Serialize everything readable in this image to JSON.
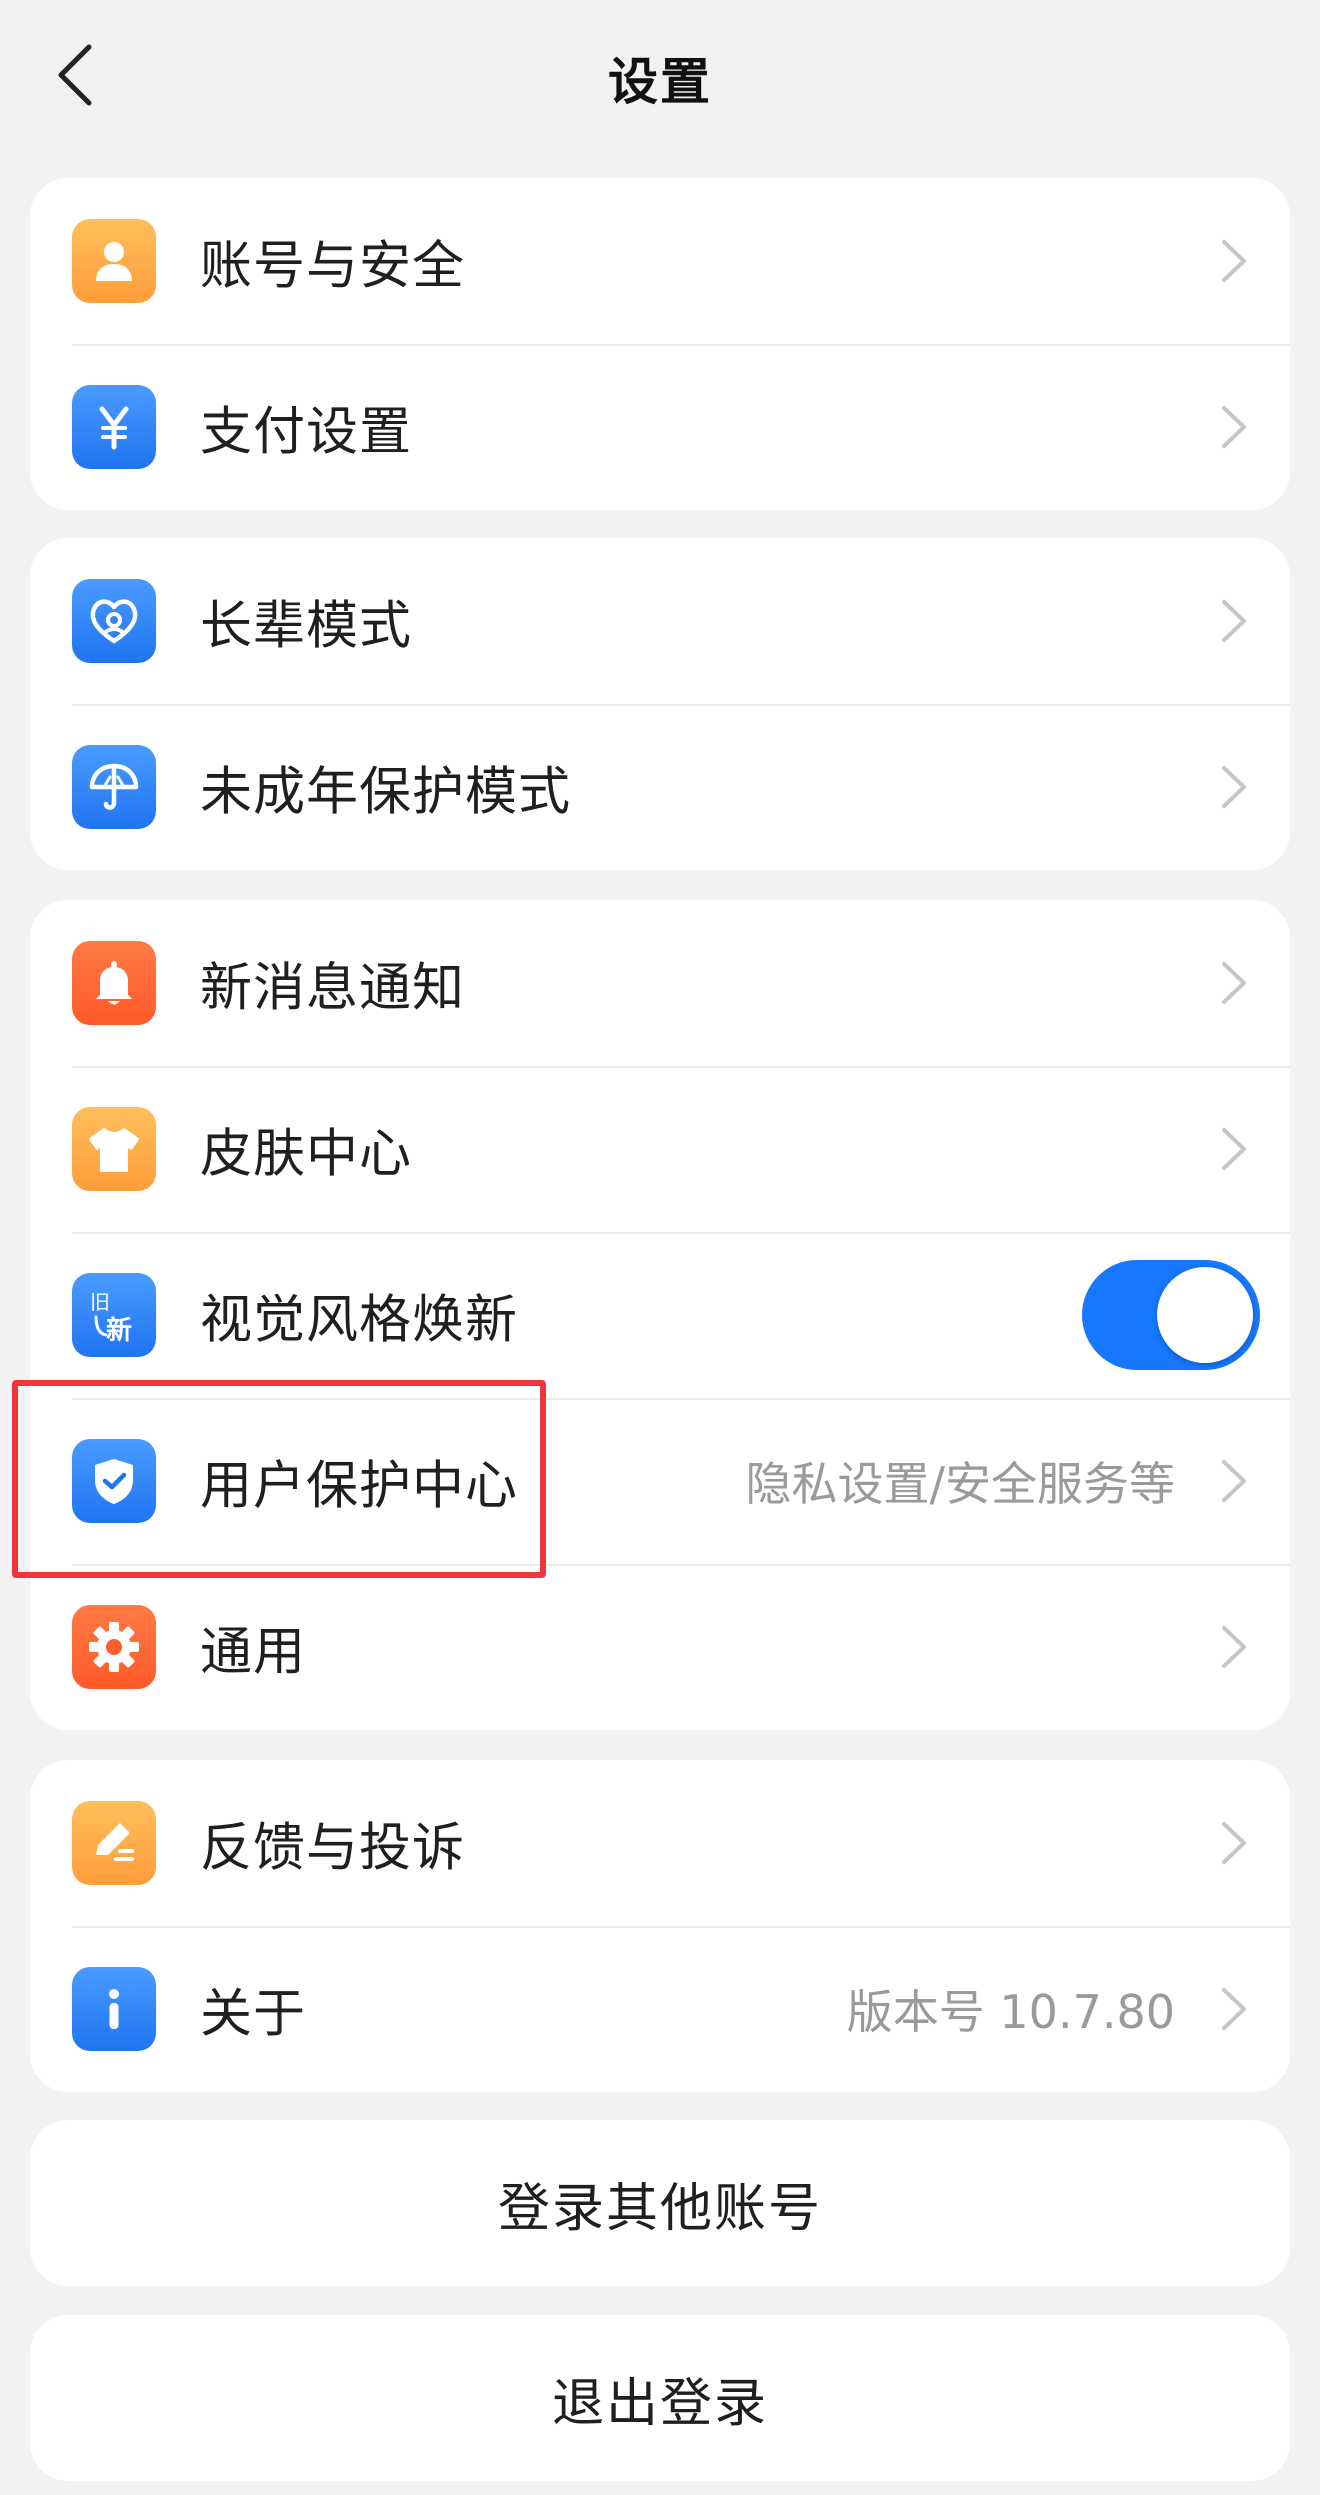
{
  "header": {
    "title": "设置"
  },
  "groups": [
    {
      "items": [
        {
          "label": "账号与安全",
          "icon": "user-icon",
          "color": "#ffa64a"
        },
        {
          "label": "支付设置",
          "icon": "yuan-icon",
          "color": "#2f84f7"
        }
      ]
    },
    {
      "items": [
        {
          "label": "长辈模式",
          "icon": "heart-icon",
          "color": "#2f84f7"
        },
        {
          "label": "未成年保护模式",
          "icon": "umbrella-icon",
          "color": "#2f84f7"
        }
      ]
    },
    {
      "items": [
        {
          "label": "新消息通知",
          "icon": "bell-icon",
          "color": "#ff5f2e"
        },
        {
          "label": "皮肤中心",
          "icon": "tshirt-icon",
          "color": "#ffa64a"
        },
        {
          "label": "视觉风格焕新",
          "icon": "old-new-icon",
          "color": "#2f84f7",
          "icon_text_old": "旧",
          "icon_text_new": "新",
          "toggle_on": true
        },
        {
          "label": "用户保护中心",
          "icon": "shield-check-icon",
          "color": "#2f84f7",
          "subtext": "隐私设置/安全服务等"
        },
        {
          "label": "通用",
          "icon": "gear-icon",
          "color": "#ff5f2e"
        }
      ]
    },
    {
      "items": [
        {
          "label": "反馈与投诉",
          "icon": "edit-pen-icon",
          "color": "#ffa64a"
        },
        {
          "label": "关于",
          "icon": "info-icon",
          "color": "#2f84f7",
          "subtext": "版本号 10.7.80"
        }
      ]
    }
  ],
  "actions": {
    "switch_account": "登录其他账号",
    "logout": "退出登录"
  },
  "accent_color": "#1677ff",
  "highlight_color": "#f0353a"
}
